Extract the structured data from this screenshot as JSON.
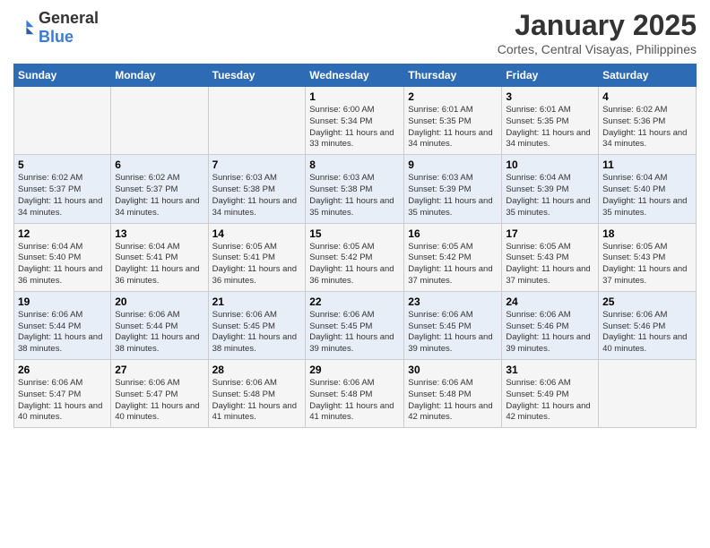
{
  "logo": {
    "general": "General",
    "blue": "Blue"
  },
  "title": "January 2025",
  "subtitle": "Cortes, Central Visayas, Philippines",
  "days_header": [
    "Sunday",
    "Monday",
    "Tuesday",
    "Wednesday",
    "Thursday",
    "Friday",
    "Saturday"
  ],
  "weeks": [
    [
      {
        "num": "",
        "info": ""
      },
      {
        "num": "",
        "info": ""
      },
      {
        "num": "",
        "info": ""
      },
      {
        "num": "1",
        "info": "Sunrise: 6:00 AM\nSunset: 5:34 PM\nDaylight: 11 hours and 33 minutes."
      },
      {
        "num": "2",
        "info": "Sunrise: 6:01 AM\nSunset: 5:35 PM\nDaylight: 11 hours and 34 minutes."
      },
      {
        "num": "3",
        "info": "Sunrise: 6:01 AM\nSunset: 5:35 PM\nDaylight: 11 hours and 34 minutes."
      },
      {
        "num": "4",
        "info": "Sunrise: 6:02 AM\nSunset: 5:36 PM\nDaylight: 11 hours and 34 minutes."
      }
    ],
    [
      {
        "num": "5",
        "info": "Sunrise: 6:02 AM\nSunset: 5:37 PM\nDaylight: 11 hours and 34 minutes."
      },
      {
        "num": "6",
        "info": "Sunrise: 6:02 AM\nSunset: 5:37 PM\nDaylight: 11 hours and 34 minutes."
      },
      {
        "num": "7",
        "info": "Sunrise: 6:03 AM\nSunset: 5:38 PM\nDaylight: 11 hours and 34 minutes."
      },
      {
        "num": "8",
        "info": "Sunrise: 6:03 AM\nSunset: 5:38 PM\nDaylight: 11 hours and 35 minutes."
      },
      {
        "num": "9",
        "info": "Sunrise: 6:03 AM\nSunset: 5:39 PM\nDaylight: 11 hours and 35 minutes."
      },
      {
        "num": "10",
        "info": "Sunrise: 6:04 AM\nSunset: 5:39 PM\nDaylight: 11 hours and 35 minutes."
      },
      {
        "num": "11",
        "info": "Sunrise: 6:04 AM\nSunset: 5:40 PM\nDaylight: 11 hours and 35 minutes."
      }
    ],
    [
      {
        "num": "12",
        "info": "Sunrise: 6:04 AM\nSunset: 5:40 PM\nDaylight: 11 hours and 36 minutes."
      },
      {
        "num": "13",
        "info": "Sunrise: 6:04 AM\nSunset: 5:41 PM\nDaylight: 11 hours and 36 minutes."
      },
      {
        "num": "14",
        "info": "Sunrise: 6:05 AM\nSunset: 5:41 PM\nDaylight: 11 hours and 36 minutes."
      },
      {
        "num": "15",
        "info": "Sunrise: 6:05 AM\nSunset: 5:42 PM\nDaylight: 11 hours and 36 minutes."
      },
      {
        "num": "16",
        "info": "Sunrise: 6:05 AM\nSunset: 5:42 PM\nDaylight: 11 hours and 37 minutes."
      },
      {
        "num": "17",
        "info": "Sunrise: 6:05 AM\nSunset: 5:43 PM\nDaylight: 11 hours and 37 minutes."
      },
      {
        "num": "18",
        "info": "Sunrise: 6:05 AM\nSunset: 5:43 PM\nDaylight: 11 hours and 37 minutes."
      }
    ],
    [
      {
        "num": "19",
        "info": "Sunrise: 6:06 AM\nSunset: 5:44 PM\nDaylight: 11 hours and 38 minutes."
      },
      {
        "num": "20",
        "info": "Sunrise: 6:06 AM\nSunset: 5:44 PM\nDaylight: 11 hours and 38 minutes."
      },
      {
        "num": "21",
        "info": "Sunrise: 6:06 AM\nSunset: 5:45 PM\nDaylight: 11 hours and 38 minutes."
      },
      {
        "num": "22",
        "info": "Sunrise: 6:06 AM\nSunset: 5:45 PM\nDaylight: 11 hours and 39 minutes."
      },
      {
        "num": "23",
        "info": "Sunrise: 6:06 AM\nSunset: 5:45 PM\nDaylight: 11 hours and 39 minutes."
      },
      {
        "num": "24",
        "info": "Sunrise: 6:06 AM\nSunset: 5:46 PM\nDaylight: 11 hours and 39 minutes."
      },
      {
        "num": "25",
        "info": "Sunrise: 6:06 AM\nSunset: 5:46 PM\nDaylight: 11 hours and 40 minutes."
      }
    ],
    [
      {
        "num": "26",
        "info": "Sunrise: 6:06 AM\nSunset: 5:47 PM\nDaylight: 11 hours and 40 minutes."
      },
      {
        "num": "27",
        "info": "Sunrise: 6:06 AM\nSunset: 5:47 PM\nDaylight: 11 hours and 40 minutes."
      },
      {
        "num": "28",
        "info": "Sunrise: 6:06 AM\nSunset: 5:48 PM\nDaylight: 11 hours and 41 minutes."
      },
      {
        "num": "29",
        "info": "Sunrise: 6:06 AM\nSunset: 5:48 PM\nDaylight: 11 hours and 41 minutes."
      },
      {
        "num": "30",
        "info": "Sunrise: 6:06 AM\nSunset: 5:48 PM\nDaylight: 11 hours and 42 minutes."
      },
      {
        "num": "31",
        "info": "Sunrise: 6:06 AM\nSunset: 5:49 PM\nDaylight: 11 hours and 42 minutes."
      },
      {
        "num": "",
        "info": ""
      }
    ]
  ]
}
